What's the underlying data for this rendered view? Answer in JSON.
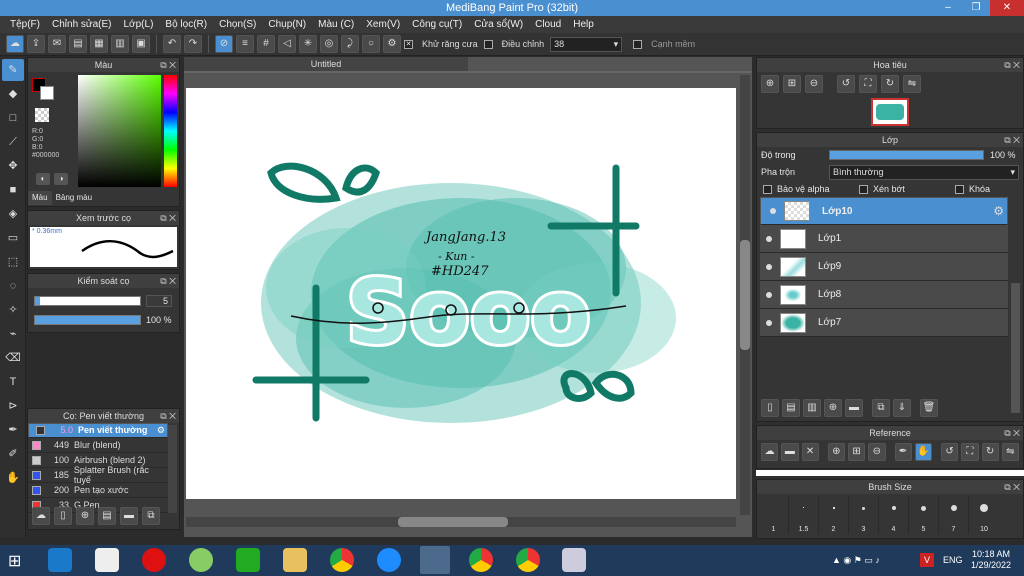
{
  "window": {
    "title": "MediBang Paint Pro (32bit)",
    "minimize": "–",
    "maximize": "❐",
    "close": "✕"
  },
  "menu": [
    "Tệp(F)",
    "Chỉnh sửa(E)",
    "Lớp(L)",
    "Bộ lọc(R)",
    "Chọn(S)",
    "Chụp(N)",
    "Màu (C)",
    "Xem(V)",
    "Công cụ(T)",
    "Cửa sổ(W)",
    "Cloud",
    "Help"
  ],
  "toolbar": {
    "antialias_label": "Khử răng cưa",
    "adjust_label": "Điều chỉnh",
    "adjust_value": "38",
    "edge_label": "Cạnh mềm"
  },
  "color_panel": {
    "title": "Màu",
    "r": "R:0",
    "g": "G:0",
    "b": "B:0",
    "hex": "#000000",
    "tab1": "Màu",
    "tab2": "Bảng màu"
  },
  "brush_preview": {
    "title": "Xem trước cọ",
    "size": "0.36mm"
  },
  "brush_control": {
    "title": "Kiểm soát cọ",
    "size_value": "5",
    "opacity_value": "100 %",
    "size_fraction": 0.05,
    "opacity_fraction": 1.0
  },
  "brush_list": {
    "title": "Cọ: Pen viết thường",
    "items": [
      {
        "size": "5.0",
        "name": "Pen viết thường",
        "color": "#333333"
      },
      {
        "size": "449",
        "name": "Blur (blend)",
        "color": "#ff88cc"
      },
      {
        "size": "100",
        "name": "Airbrush (blend 2)",
        "color": "#cccccc"
      },
      {
        "size": "185",
        "name": "Splatter Brush (rắc tuyế",
        "color": "#3355ee"
      },
      {
        "size": "200",
        "name": "Pen tạo xước",
        "color": "#3355ee"
      },
      {
        "size": "33",
        "name": "G Pen",
        "color": "#ee3333"
      }
    ]
  },
  "document": {
    "tab": "Untitled"
  },
  "artwork": {
    "line1": "JangJang.13",
    "line2": "- Kun -",
    "line3": "#HD247",
    "word": "Sooo"
  },
  "navigator": {
    "title": "Hoa tiêu"
  },
  "layer_panel": {
    "title": "Lớp",
    "opacity_label": "Độ trong",
    "opacity_value": "100 %",
    "opacity_fraction": 1.0,
    "blend_label": "Pha trộn",
    "blend_value": "Bình thường",
    "protect_alpha": "Bảo vệ alpha",
    "clip": "Xén bớt",
    "lock": "Khóa",
    "layers": [
      {
        "name": "Lớp10",
        "selected": true
      },
      {
        "name": "Lớp1",
        "selected": false
      },
      {
        "name": "Lớp9",
        "selected": false
      },
      {
        "name": "Lớp8",
        "selected": false
      },
      {
        "name": "Lớp7",
        "selected": false
      }
    ]
  },
  "reference": {
    "title": "Reference"
  },
  "brush_size": {
    "title": "Brush Size",
    "sizes": [
      "1",
      "1.5",
      "2",
      "3",
      "4",
      "5",
      "7",
      "10"
    ]
  },
  "taskbar": {
    "lang": "ENG",
    "time": "10:18 AM",
    "date": "1/29/2022"
  }
}
